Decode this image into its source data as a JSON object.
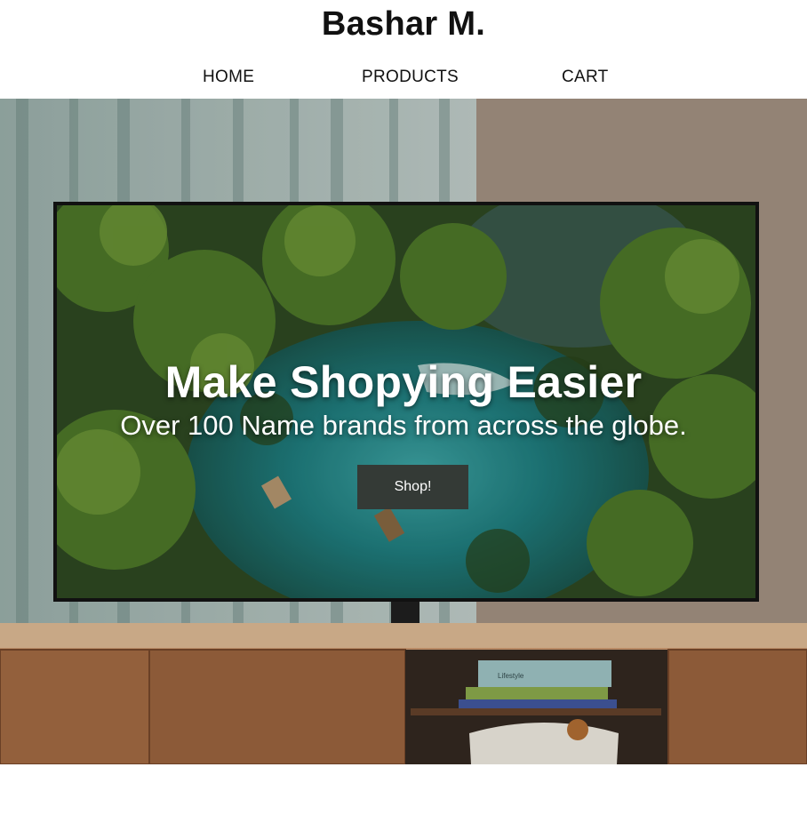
{
  "site": {
    "brand": "Bashar M."
  },
  "nav": {
    "items": [
      {
        "label": "HOME"
      },
      {
        "label": "PRODUCTS"
      },
      {
        "label": "CART"
      }
    ]
  },
  "hero": {
    "title": "Make Shopying Easier",
    "subtitle": "Over 100 Name brands from across the globe.",
    "button_label": "Shop!",
    "book_spine_text": "Lifestyle"
  },
  "colors": {
    "button_bg": "#343a36",
    "text_dark": "#111111",
    "hero_text": "#ffffff",
    "wall": "#b8a898",
    "wood": "#8a5a38"
  }
}
